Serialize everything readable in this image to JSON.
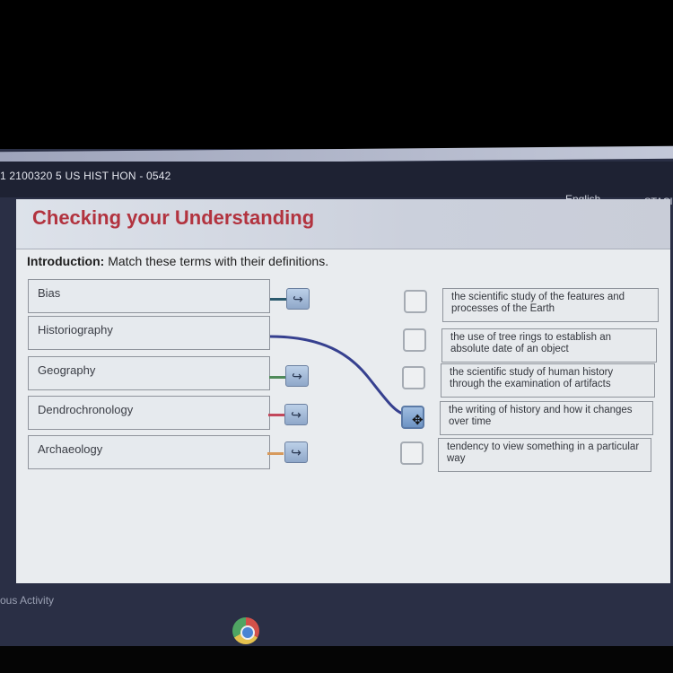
{
  "app": {
    "course_title": "1  2100320  5  US HIST HON - 0542",
    "language": "English",
    "user_name": "STACI",
    "footer_link": "ous Activity"
  },
  "page": {
    "title": "Checking your Understanding",
    "intro_label": "Introduction:",
    "intro_text": " Match these terms with their definitions."
  },
  "terms": [
    {
      "label": "Bias",
      "connector_color": "#2c5a6e",
      "matched_to": null
    },
    {
      "label": "Historiography",
      "connector_color": "#36408f",
      "matched_to": 3
    },
    {
      "label": "Geography",
      "connector_color": "#4f8a5a",
      "matched_to": null
    },
    {
      "label": "Dendrochronology",
      "connector_color": "#c2475b",
      "matched_to": null
    },
    {
      "label": "Archaeology",
      "connector_color": "#d79a5d",
      "matched_to": null
    }
  ],
  "definitions": [
    {
      "text": "the scientific study of the features and processes of the Earth"
    },
    {
      "text": "the use of tree rings to establish an absolute date of an object"
    },
    {
      "text": "the scientific study of human history through the examination of artifacts"
    },
    {
      "text": "the writing of history and how it changes over time"
    },
    {
      "text": "tendency to view something in a particular way"
    }
  ],
  "icons": {
    "handle": "↪",
    "chevron": "⌄",
    "move": "✥"
  }
}
